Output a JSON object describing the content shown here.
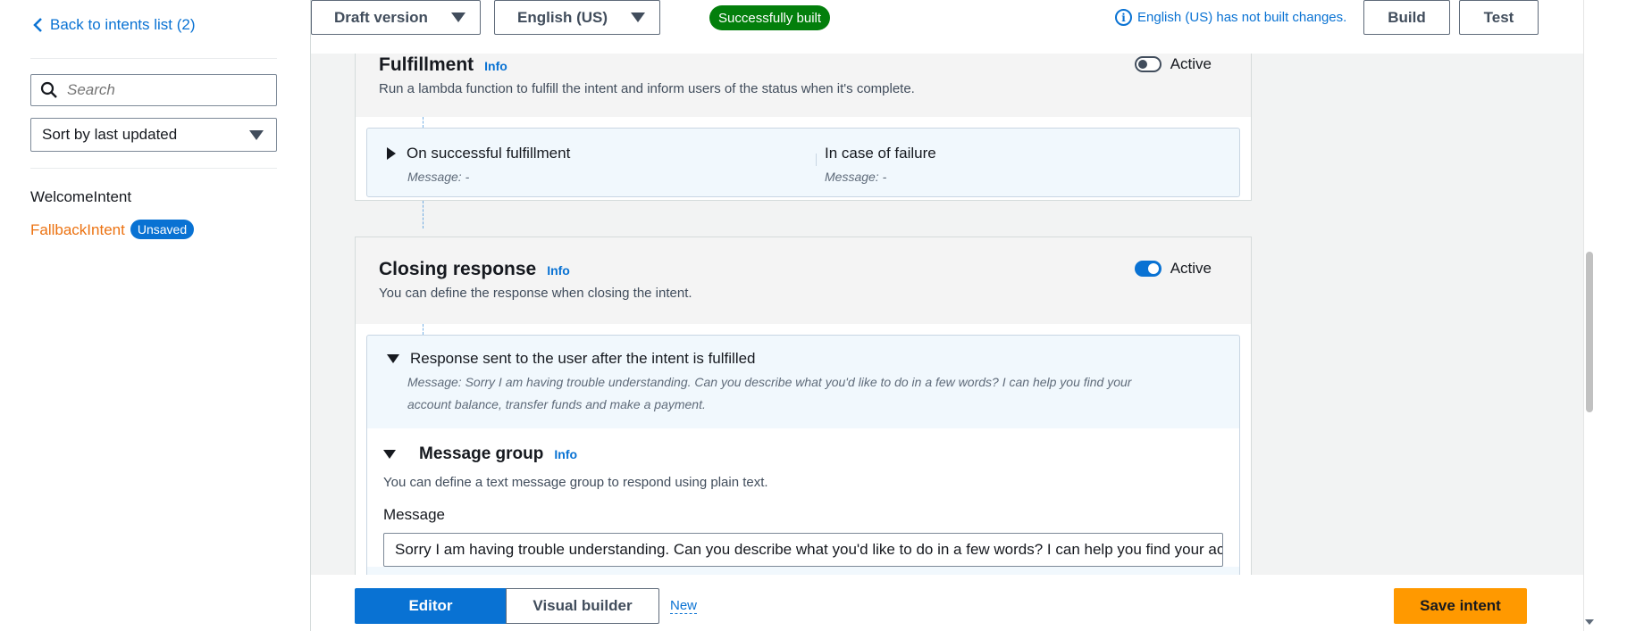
{
  "sidebar": {
    "back_label": "Back to intents list (2)",
    "search_placeholder": "Search",
    "sort_label": "Sort by last updated",
    "intents": [
      {
        "name": "WelcomeIntent",
        "badge": ""
      },
      {
        "name": "FallbackIntent",
        "badge": "Unsaved"
      }
    ]
  },
  "topbar": {
    "version_label": "Draft version",
    "language_label": "English (US)",
    "build_status": "Successfully built",
    "notice": "English (US) has not built changes.",
    "build_label": "Build",
    "test_label": "Test"
  },
  "fulfillment": {
    "title": "Fulfillment",
    "info": "Info",
    "description": "Run a lambda function to fulfill the intent and inform users of the status when it's complete.",
    "toggle_label": "Active",
    "toggle_on": false,
    "success_title": "On successful fulfillment",
    "success_message": "Message: -",
    "failure_title": "In case of failure",
    "failure_message": "Message: -"
  },
  "closing": {
    "title": "Closing response",
    "info": "Info",
    "description": "You can define the response when closing the intent.",
    "toggle_label": "Active",
    "toggle_on": true,
    "response_title": "Response sent to the user after the intent is fulfilled",
    "response_message_line1": "Message: Sorry I am having trouble understanding. Can you describe what you'd like to do in a few words? I can help you find your",
    "response_message_line2": "account balance, transfer funds and make a payment.",
    "group_title": "Message group",
    "group_info": "Info",
    "group_description": "You can define a text message group to respond using plain text.",
    "message_label": "Message",
    "message_value": "Sorry I am having trouble understanding. Can you describe what you'd like to do in a few words? I can help you find your account balance, transfer funds and make a payment."
  },
  "bottombar": {
    "editor_label": "Editor",
    "visual_label": "Visual builder",
    "new_label": "New",
    "save_label": "Save intent"
  },
  "colors": {
    "link": "#0972d3",
    "active_intent": "#ec7211",
    "success": "#037f0c",
    "primary_button": "#ff9900"
  }
}
